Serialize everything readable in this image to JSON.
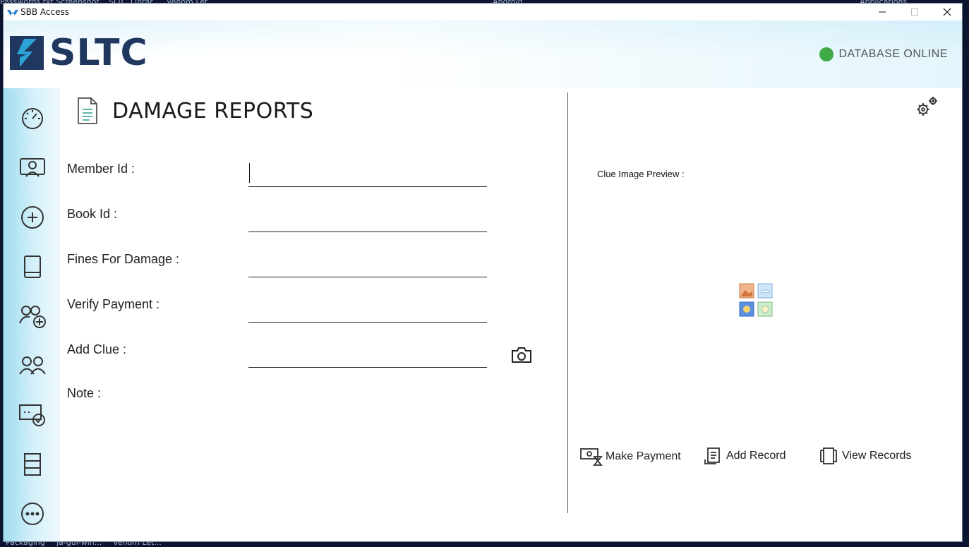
{
  "desktop": {
    "top_items": [
      "Passwords.txt Screenshot",
      "SLTC_Librar...",
      "Venom Let...",
      "Android",
      "Applications"
    ],
    "bottom_items": [
      "Packaging",
      "ja-gui-win...",
      "Venom Let..."
    ]
  },
  "window": {
    "title": "SBB Access",
    "minimize_icon": "minimize-icon",
    "maximize_icon": "maximize-icon",
    "close_icon": "close-icon"
  },
  "header": {
    "logo_text": "SLTC",
    "db_status_label": "DATABASE ONLINE",
    "db_status_color": "#3faa47"
  },
  "sidebar": {
    "items": [
      {
        "icon": "dashboard-gauge-icon"
      },
      {
        "icon": "member-card-icon"
      },
      {
        "icon": "add-circle-icon"
      },
      {
        "icon": "book-icon"
      },
      {
        "icon": "add-member-icon"
      },
      {
        "icon": "members-icon"
      },
      {
        "icon": "payment-check-icon"
      },
      {
        "icon": "records-stack-icon"
      },
      {
        "icon": "more-icon"
      }
    ]
  },
  "page": {
    "title": "DAMAGE REPORTS",
    "title_icon": "document-icon"
  },
  "form": {
    "member_id_label": "Member Id :",
    "member_id_value": "",
    "book_id_label": "Book Id :",
    "book_id_value": "",
    "fines_label": "Fines For Damage :",
    "fines_value": "",
    "verify_label": "Verify Payment :",
    "verify_value": "",
    "clue_label": "Add Clue :",
    "clue_value": "",
    "note_label": "Note :",
    "camera_icon": "camera-icon"
  },
  "preview": {
    "label": "Clue Image Preview :",
    "placeholder_icon": "image-placeholder-icon"
  },
  "actions": {
    "make_payment": "Make Payment",
    "add_record": "Add Record",
    "view_records": "View Records"
  },
  "colors": {
    "accent": "#20385f",
    "online": "#3faa47",
    "sidebar_start": "#9fdcf0"
  }
}
